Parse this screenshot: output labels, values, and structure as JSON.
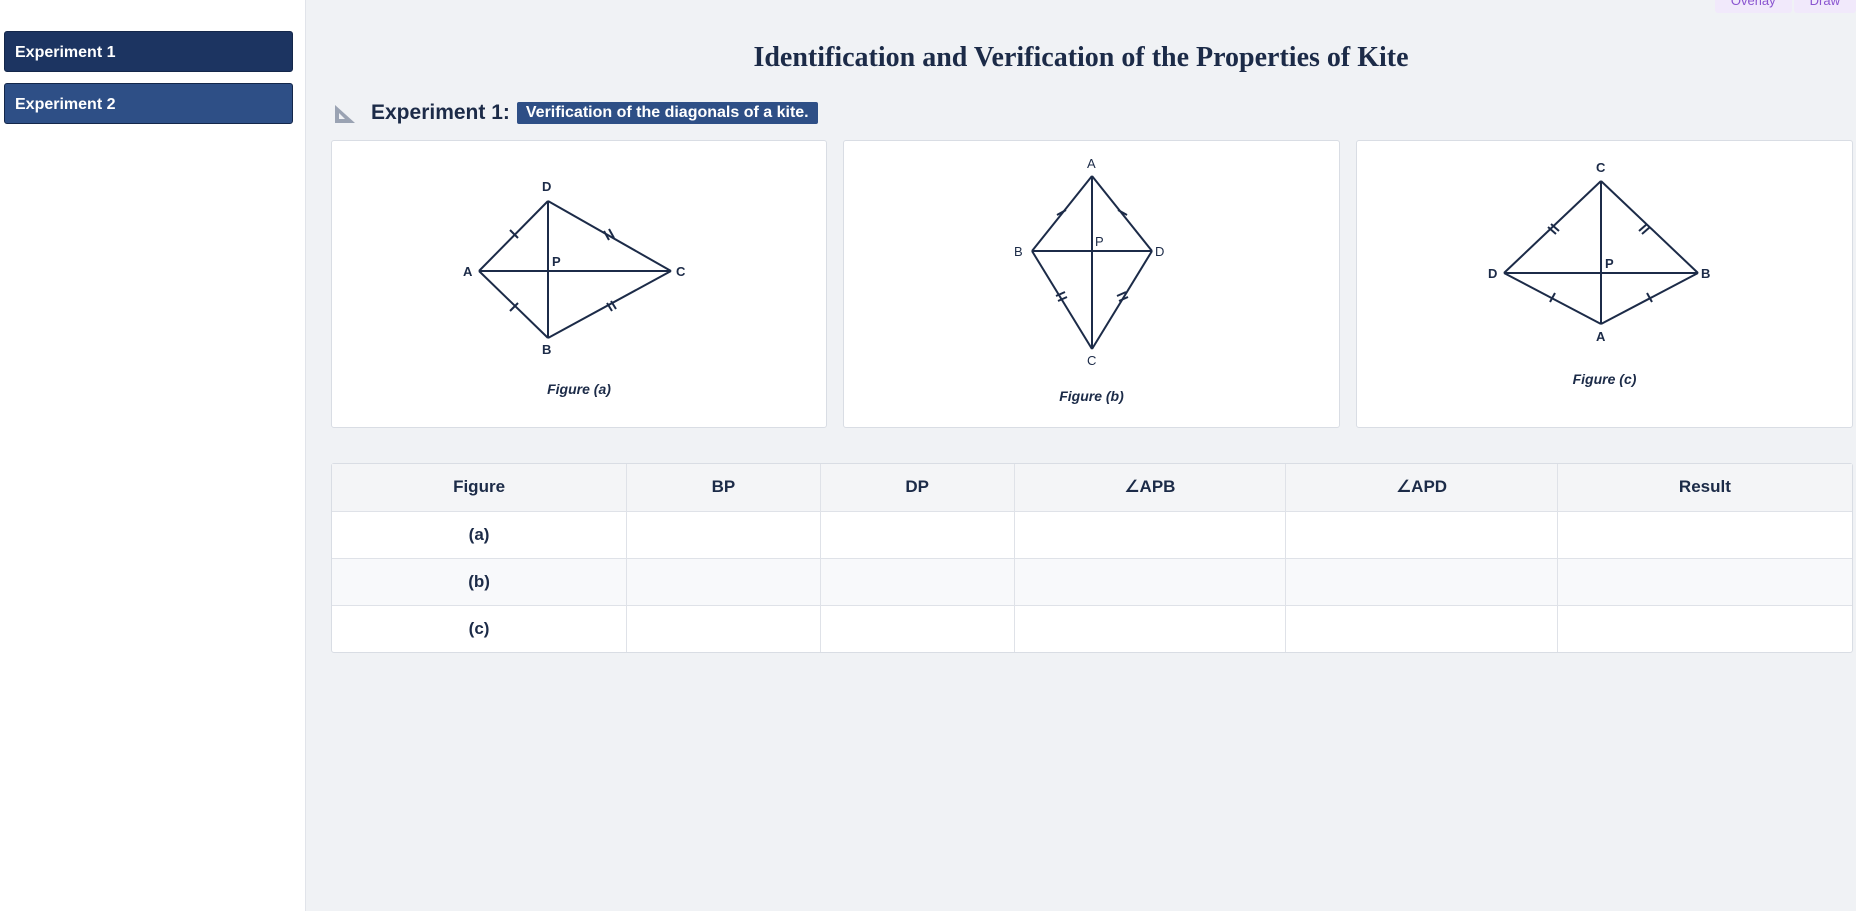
{
  "sidebar": {
    "items": [
      {
        "label": "Experiment 1"
      },
      {
        "label": "Experiment 2"
      }
    ]
  },
  "topbar": {
    "overlay": "Overlay",
    "draw": "Draw"
  },
  "page": {
    "title": "Identification and Verification of the Properties of Kite"
  },
  "experiment": {
    "label": "Experiment 1:",
    "description": "Verification of the diagonals of a kite."
  },
  "figures": [
    {
      "caption": "Figure (a)",
      "labels": {
        "top": "D",
        "left": "A",
        "right": "C",
        "bottom": "B",
        "center": "P"
      }
    },
    {
      "caption": "Figure (b)",
      "labels": {
        "top": "A",
        "left": "B",
        "right": "D",
        "bottom": "C",
        "center": "P"
      }
    },
    {
      "caption": "Figure (c)",
      "labels": {
        "top": "C",
        "left": "D",
        "right": "B",
        "bottom": "A",
        "center": "P"
      }
    }
  ],
  "table": {
    "headers": [
      "Figure",
      "BP",
      "DP",
      "∠APB",
      "∠APD",
      "Result"
    ],
    "rows": [
      [
        "(a)",
        "",
        "",
        "",
        "",
        ""
      ],
      [
        "(b)",
        "",
        "",
        "",
        "",
        ""
      ],
      [
        "(c)",
        "",
        "",
        "",
        "",
        ""
      ]
    ]
  },
  "colors": {
    "navy": "#1c3461",
    "accent": "#2e4f86",
    "purple": "#8a55d0"
  }
}
